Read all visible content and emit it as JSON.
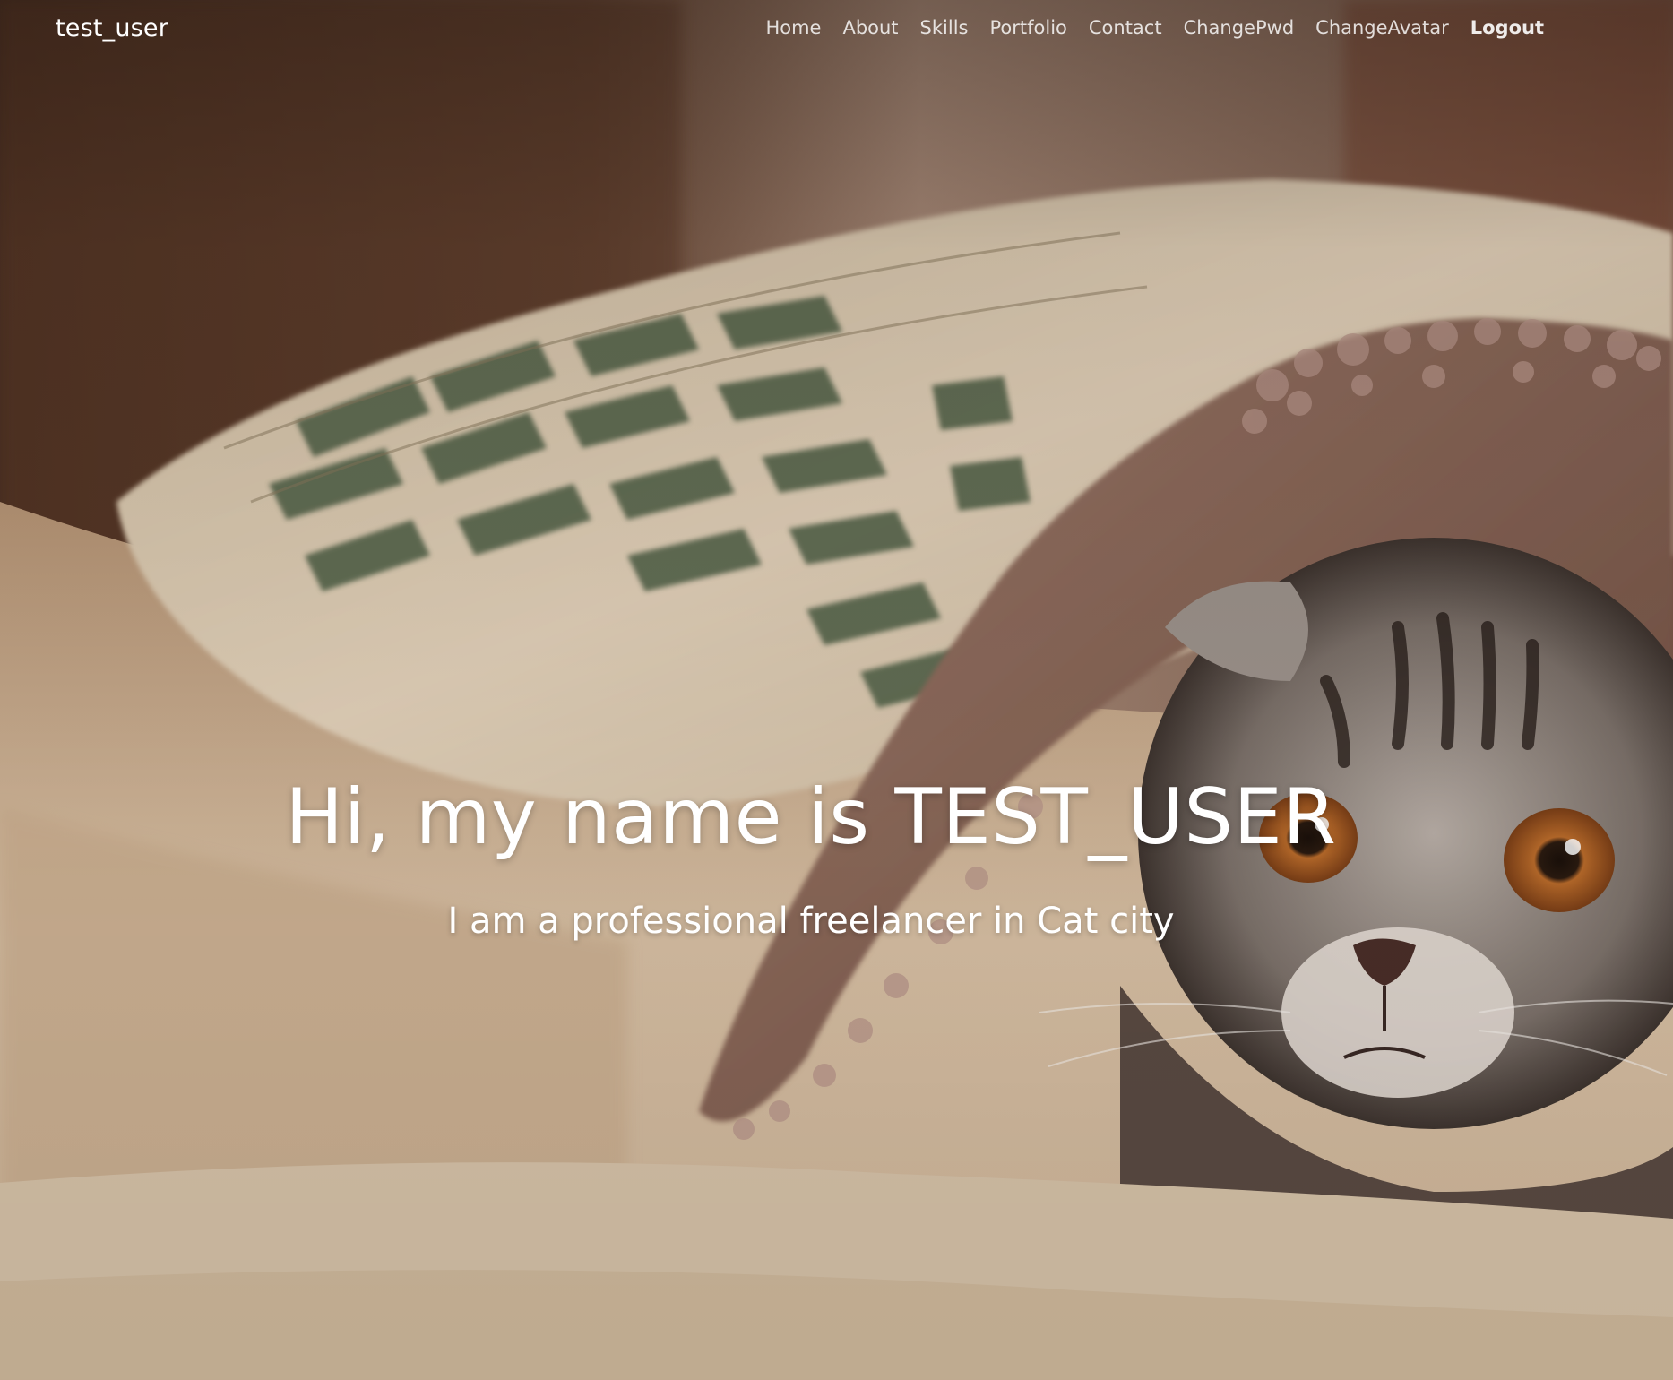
{
  "navbar": {
    "brand": "test_user",
    "links": [
      {
        "label": "Home"
      },
      {
        "label": "About"
      },
      {
        "label": "Skills"
      },
      {
        "label": "Portfolio"
      },
      {
        "label": "Contact"
      },
      {
        "label": "ChangePwd"
      },
      {
        "label": "ChangeAvatar"
      },
      {
        "label": "Logout"
      }
    ]
  },
  "hero": {
    "title": "Hi, my name is TEST_USER",
    "subtitle": "I am a professional freelancer in Cat city",
    "background_image": "cat-under-blanket-photo"
  },
  "colors": {
    "text": "#ffffff",
    "nav_text": "#e8e1dc"
  }
}
